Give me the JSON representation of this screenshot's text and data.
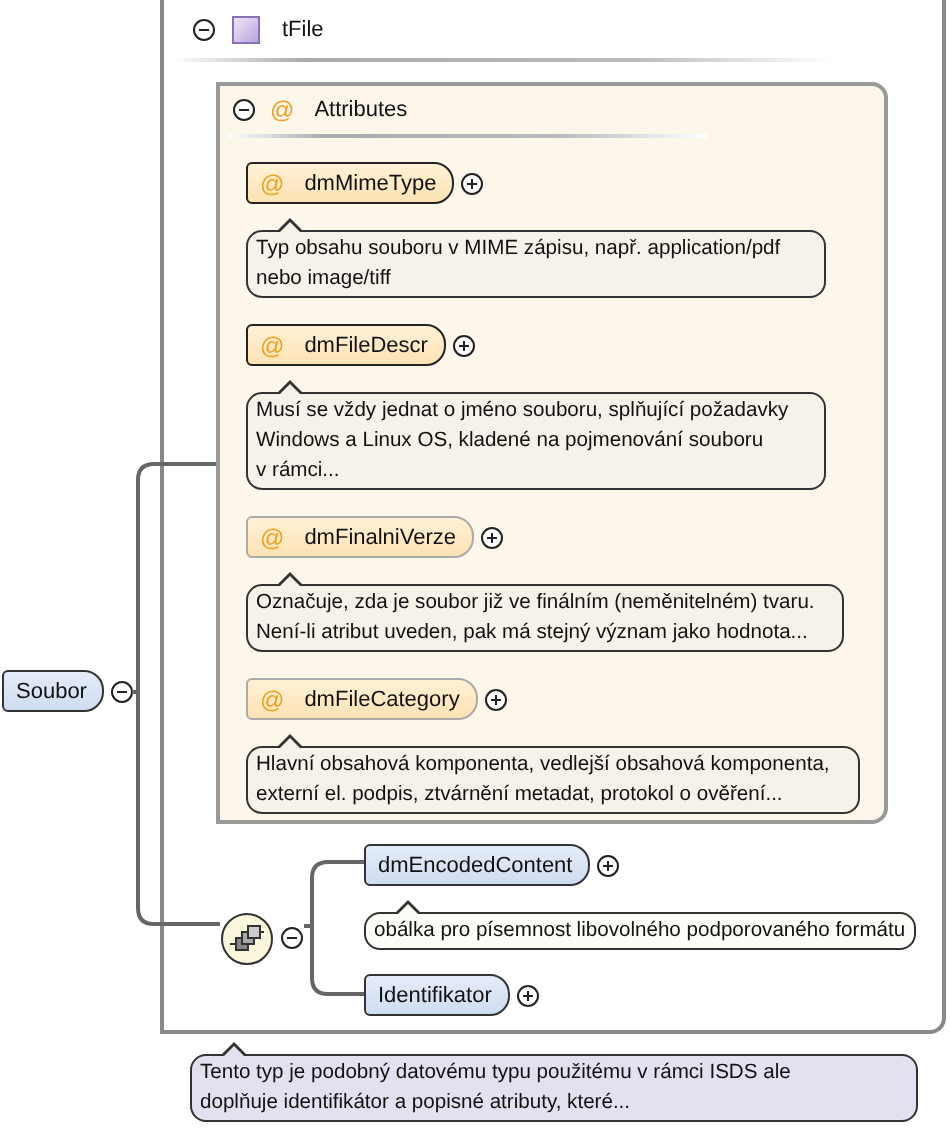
{
  "root": {
    "name": "Soubor",
    "expanded": true
  },
  "type": {
    "name": "tFile",
    "expanded": true,
    "attributes": {
      "marker": "@",
      "label": "Attributes",
      "expanded": true,
      "items": [
        {
          "marker": "@",
          "name": "dmMimeType",
          "required": true,
          "expanded": false,
          "doc": "Typ obsahu souboru v MIME zápisu, např. application/pdf\nnebo image/tiff"
        },
        {
          "marker": "@",
          "name": "dmFileDescr",
          "required": true,
          "expanded": false,
          "doc": "Musí se vždy jednat o jméno souboru, splňující požadavky\nWindows a Linux OS, kladené na pojmenování souboru\nv rámci..."
        },
        {
          "marker": "@",
          "name": "dmFinalniVerze",
          "required": false,
          "expanded": false,
          "doc": "Označuje, zda je soubor již ve finálním (neměnitelném) tvaru.\nNení-li atribut uveden, pak má stejný význam jako hodnota..."
        },
        {
          "marker": "@",
          "name": "dmFileCategory",
          "required": false,
          "expanded": false,
          "doc": "Hlavní obsahová komponenta, vedlejší obsahová komponenta,\nexterní el. podpis, ztvárnění metadat, protokol o ověření..."
        }
      ]
    },
    "sequence": {
      "expanded": true,
      "elements": [
        {
          "name": "dmEncodedContent",
          "expanded": false,
          "doc": "obálka pro písemnost libovolného podporovaného formátu"
        },
        {
          "name": "Identifikator",
          "expanded": false
        }
      ]
    },
    "doc": "Tento typ je podobný datovému typu použitému v rámci ISDS ale\ndoplňuje identifikátor a popisné atributy, které..."
  }
}
